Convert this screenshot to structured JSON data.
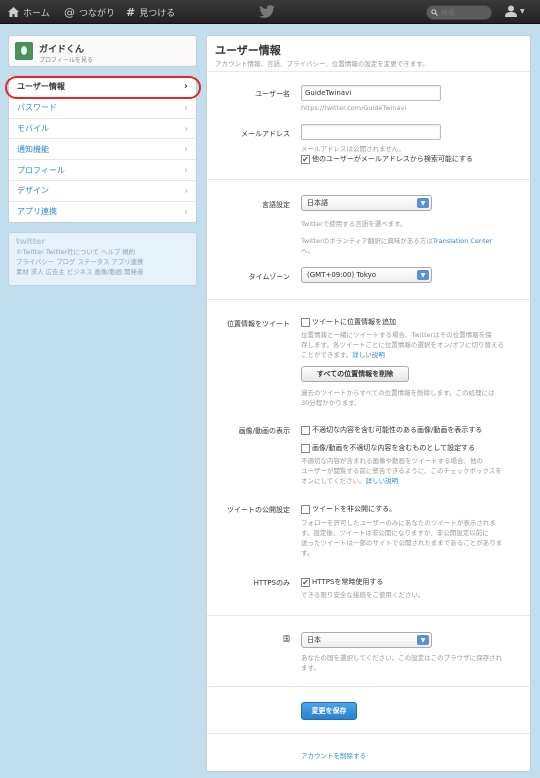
{
  "topbar": {
    "home_label": "ホーム",
    "connect_label": "つながり",
    "discover_label": "見つける",
    "search_placeholder": "検索",
    "user_icon": "person-icon"
  },
  "profile": {
    "name": "ガイドくん",
    "link": "プロフィールを見る"
  },
  "menu": {
    "items": [
      {
        "label": "ユーザー情報"
      },
      {
        "label": "パスワード"
      },
      {
        "label": "モバイル"
      },
      {
        "label": "通知機能"
      },
      {
        "label": "プロフィール"
      },
      {
        "label": "デザイン"
      },
      {
        "label": "アプリ連携"
      }
    ]
  },
  "footer": {
    "logo": "twitter",
    "line1": "©Twitter  Twitter社について  ヘルプ  規約",
    "line2": "プライバシー  ブログ  ステータス  アプリ連携",
    "line3": "素材  求人  広告主  ビジネス  画像/動画  開発者"
  },
  "main": {
    "title": "ユーザー情報",
    "subtitle": "アカウント情報、言語、プライバシー、位置情報の設定を変更できます。",
    "username": {
      "label": "ユーザー名",
      "value": "GuideTwinavi",
      "url": "https://twitter.com/GuideTwinavi"
    },
    "email": {
      "label": "メールアドレス",
      "value": "",
      "help": "メールアドレスは公開されません。",
      "search_check": "他のユーザーがメールアドレスから検索可能にする"
    },
    "language": {
      "label": "言語設定",
      "value": "日本語",
      "help1": "Twitterで使用する言語を選べます。",
      "help2": "Twitterのボランティア翻訳に興味がある方は",
      "help2_link": "Translation Center",
      "help3": "へ。"
    },
    "timezone": {
      "label": "タイムゾーン",
      "value": "(GMT+09:00) Tokyo"
    },
    "location": {
      "label": "位置情報をツイート",
      "check": "ツイートに位置情報を追加",
      "help1": "位置情報と一緒にツイートする場合、Twitterはその位置情報を保",
      "help2": "存します。各ツイートごとに位置情報の選択をオン/オフに切り替える",
      "help3": "ことができます。",
      "help_link": "詳しい説明",
      "delete_button": "すべての位置情報を削除",
      "delete_help1": "過去のツイートからすべての位置情報を削除します。この処理には",
      "delete_help2": "30分程かかります。"
    },
    "media": {
      "label": "画像/動画の表示",
      "check1": "不適切な内容を含む可能性のある画像/動画を表示する",
      "check2": "画像/動画を不適切な内容を含むものとして設定する",
      "help1": "不適切な内容が含まれる画像や動画をツイートする場合、他の",
      "help2": "ユーザーが閲覧する前に警告できるように、このチェックボックスを",
      "help3": "オンにしてください。",
      "help_link": "詳しい説明"
    },
    "privacy": {
      "label": "ツイートの公開設定",
      "check": "ツイートを非公開にする。",
      "help1": "フォローを許可したユーザーのみにあなたのツイートが表示されま",
      "help2": "す。設定後、ツイートは非公開になりますが、非公開設定以前に",
      "help3": "送ったツイートは一部のサイトで公開されたままであることがありま",
      "help4": "す。"
    },
    "https": {
      "label": "HTTPSのみ",
      "check": "HTTPSを常時使用する",
      "help": "できる限り安全な接続をご使用ください。"
    },
    "country": {
      "label": "国",
      "value": "日本",
      "help1": "あなたの国を選択してください。この設定はこのブラウザに保存され",
      "help2": "ます。"
    },
    "save_button": "変更を保存",
    "delete_account": "アカウントを削除する"
  },
  "colors": {
    "accent": "#2c8ad1",
    "highlight": "#e0262e",
    "background": "#c0deed"
  }
}
